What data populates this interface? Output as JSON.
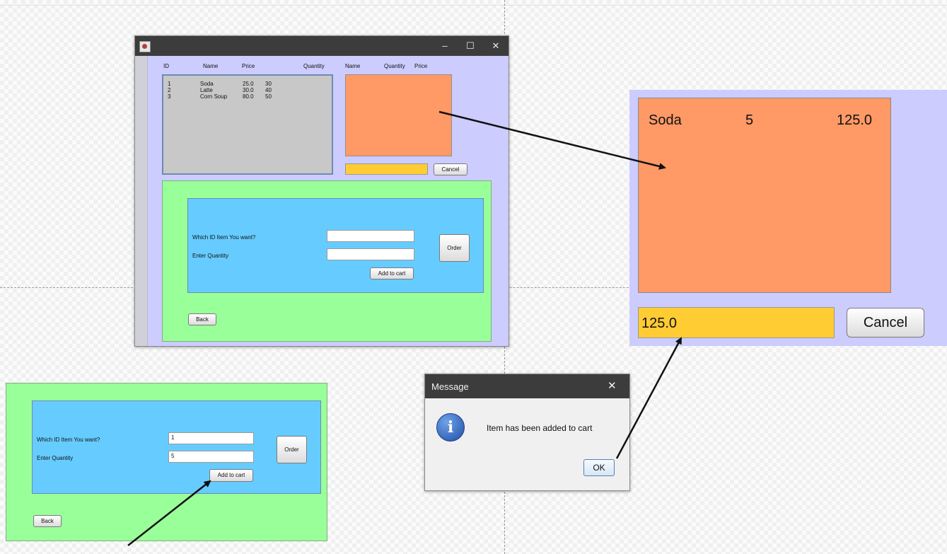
{
  "main_window": {
    "title_controls": {
      "minimize": "–",
      "maximize": "☐",
      "close": "✕"
    },
    "menu_headers": [
      "ID",
      "Name",
      "Price",
      "Quantity"
    ],
    "menu_rows": [
      {
        "id": "1",
        "name": "Soda",
        "price": "25.0",
        "quantity": "30"
      },
      {
        "id": "2",
        "name": "Latte",
        "price": "30.0",
        "quantity": "40"
      },
      {
        "id": "3",
        "name": "Corn Soup",
        "price": "80.0",
        "quantity": "50"
      }
    ],
    "cart_headers": [
      "Name",
      "Quantity",
      "Price"
    ],
    "cancel_label": "Cancel",
    "order_form": {
      "item_id_label": "Which ID Item You want?",
      "quantity_label": "Enter  Quantity",
      "item_id_value": "",
      "quantity_value": "",
      "add_to_cart_label": "Add to cart",
      "order_label": "Order",
      "back_label": "Back"
    }
  },
  "lower_form": {
    "item_id_label": "Which ID Item You want?",
    "quantity_label": "Enter  Quantity",
    "item_id_value": "1",
    "quantity_value": "5",
    "add_to_cart_label": "Add to cart",
    "order_label": "Order",
    "back_label": "Back"
  },
  "zoom_panel": {
    "cart_item": {
      "name": "Soda",
      "quantity": "5",
      "price": "125.0"
    },
    "total": "125.0",
    "cancel_label": "Cancel"
  },
  "dialog": {
    "title": "Message",
    "close": "✕",
    "message": "Item has been added to cart",
    "ok_label": "OK",
    "icon": "info-icon"
  },
  "colors": {
    "panel_lavender": "#ccccff",
    "cart_orange": "#ff9966",
    "total_yellow": "#ffcc33",
    "form_green": "#99ff99",
    "form_blue": "#66ccff",
    "menu_gray": "#c8c8c8"
  }
}
